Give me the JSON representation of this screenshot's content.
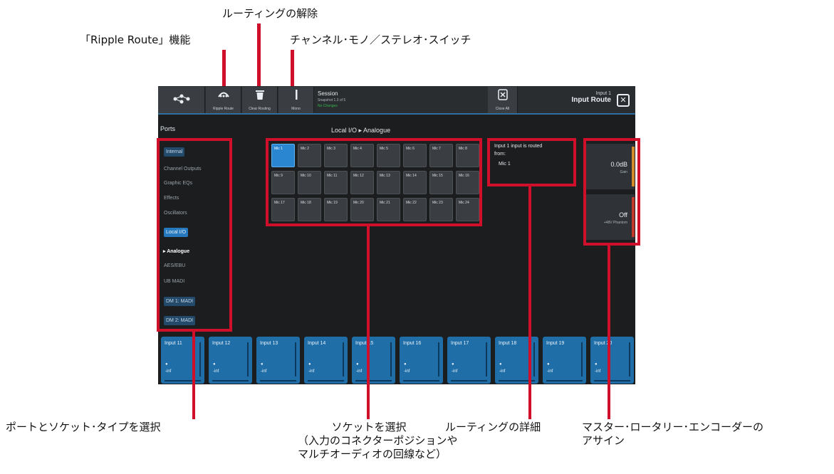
{
  "callouts": {
    "ripple_route": "「Ripple Route」機能",
    "clear_routing": "ルーティングの解除",
    "mono_stereo": "チャンネル･モノ／ステレオ･スイッチ",
    "select_port": "ポートとソケット･タイプを選択",
    "select_socket_1": "ソケットを選択",
    "select_socket_2": "（入力のコネクターポジションや",
    "select_socket_3": "マルチオーディオの回線など）",
    "routing_detail": "ルーティングの詳細",
    "encoder_1": "マスター･ロータリー･エンコーダーの",
    "encoder_2": "アサイン"
  },
  "toolbar": {
    "routing_icon": "routing-icon",
    "ripple_label": "Ripple Route",
    "clear_label": "Clear Routing",
    "mono_label": "Mono",
    "close_all_label": "Close All"
  },
  "session": {
    "title": "Session",
    "subtitle": "Snapshot 1.3 of 5",
    "status": "No Changes"
  },
  "header": {
    "input_number": "Input 1",
    "screen_title": "Input Route",
    "close_symbol": "✕"
  },
  "ports": {
    "heading": "Ports",
    "internal": "Internal",
    "channel_outputs": "Channel Outputs",
    "graphic_eqs": "Graphic EQs",
    "effects": "Effects",
    "oscillators": "Oscillators",
    "local_io": "Local I/O",
    "analogue": "▸ Analogue",
    "aes_ebu": "AES/EBU",
    "ub_madi": "UB MADI",
    "dm1": "DM 1: MADI",
    "dm2": "DM 2: MADI"
  },
  "breadcrumb": "Local I/O ▸ Analogue",
  "sockets": [
    "Mic 1",
    "Mic 2",
    "Mic 3",
    "Mic 4",
    "Mic 5",
    "Mic 6",
    "Mic 7",
    "Mic 8",
    "Mic 9",
    "Mic 10",
    "Mic 11",
    "Mic 12",
    "Mic 13",
    "Mic 14",
    "Mic 15",
    "Mic 16",
    "Mic 17",
    "Mic 18",
    "Mic 19",
    "Mic 20",
    "Mic 21",
    "Mic 22",
    "Mic 23",
    "Mic 24"
  ],
  "detail": {
    "line1": "Input 1 input is routed",
    "line2": "from:",
    "source": "Mic 1"
  },
  "encoders": {
    "gain_value": "0.0dB",
    "gain_label": "Gain",
    "phantom_value": "Off",
    "phantom_label": "+48V Phantom"
  },
  "strips": [
    "Input 11",
    "Input 12",
    "Input 13",
    "Input 14",
    "Input 15",
    "Input 16",
    "Input 17",
    "Input 18",
    "Input 19",
    "Input 20"
  ],
  "strip_level": "-inf",
  "colors": {
    "callout_red": "#d0102b",
    "accent_blue": "#2679bd"
  }
}
